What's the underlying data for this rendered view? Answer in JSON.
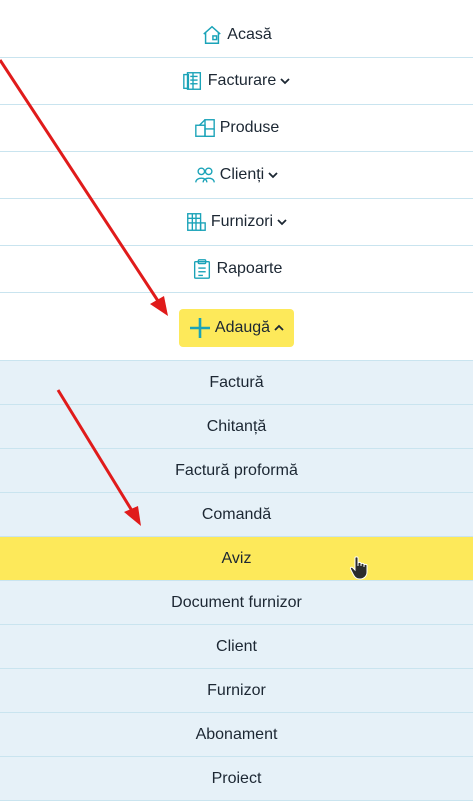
{
  "nav": {
    "items": [
      {
        "label": "Acasă",
        "icon": "home-icon",
        "dropdown": false
      },
      {
        "label": "Facturare",
        "icon": "invoices-icon",
        "dropdown": true
      },
      {
        "label": "Produse",
        "icon": "boxes-icon",
        "dropdown": false
      },
      {
        "label": "Clienți",
        "icon": "users-icon",
        "dropdown": true
      },
      {
        "label": "Furnizori",
        "icon": "suppliers-icon",
        "dropdown": true
      },
      {
        "label": "Rapoarte",
        "icon": "clipboard-icon",
        "dropdown": false
      }
    ],
    "add_label": "Adaugă"
  },
  "submenu": {
    "items": [
      "Factură",
      "Chitanță",
      "Factură proformă",
      "Comandă",
      "Aviz",
      "Document furnizor",
      "Client",
      "Furnizor",
      "Abonament",
      "Proiect"
    ],
    "active": "Aviz"
  },
  "colors": {
    "accent": "#fde95a",
    "icon": "#1aa3b8",
    "submenu_bg": "#e6f1f8",
    "border": "#c9e4ef",
    "annotation_arrow": "#e01b1b"
  }
}
